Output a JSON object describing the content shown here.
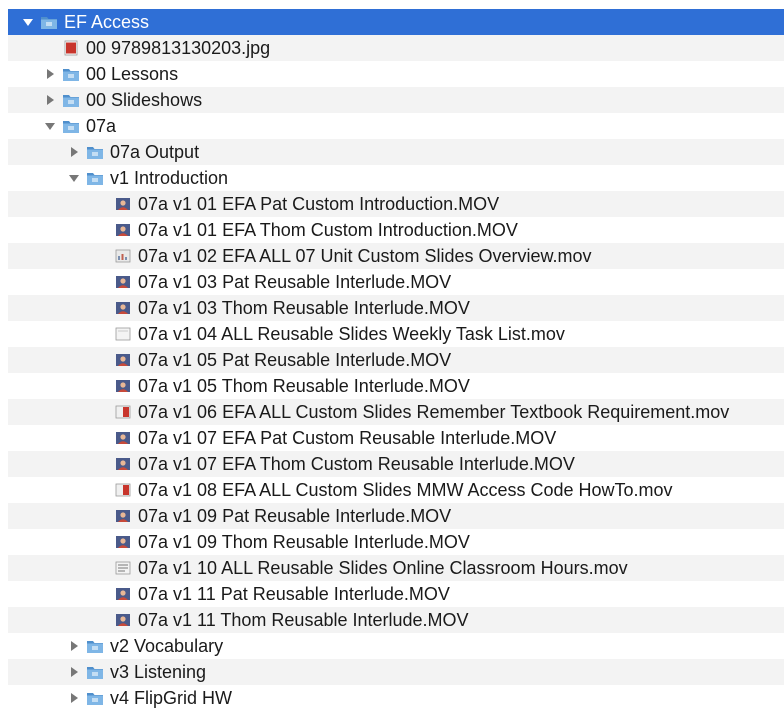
{
  "tree": {
    "rows": [
      {
        "label": "EF Access",
        "level": 0,
        "kind": "folder",
        "state": "expanded",
        "selected": true
      },
      {
        "label": "00 9789813130203.jpg",
        "level": 1,
        "kind": "image-red",
        "state": "none"
      },
      {
        "label": "00 Lessons",
        "level": 1,
        "kind": "folder",
        "state": "collapsed"
      },
      {
        "label": "00 Slideshows",
        "level": 1,
        "kind": "folder",
        "state": "collapsed"
      },
      {
        "label": "07a",
        "level": 1,
        "kind": "folder",
        "state": "expanded"
      },
      {
        "label": "07a Output",
        "level": 2,
        "kind": "folder",
        "state": "collapsed"
      },
      {
        "label": "v1 Introduction",
        "level": 2,
        "kind": "folder",
        "state": "expanded"
      },
      {
        "label": "07a v1 01 EFA Pat Custom Introduction.MOV",
        "level": 3,
        "kind": "video-person",
        "state": "none"
      },
      {
        "label": "07a v1 01 EFA Thom Custom Introduction.MOV",
        "level": 3,
        "kind": "video-person",
        "state": "none"
      },
      {
        "label": "07a v1 02 EFA ALL 07 Unit Custom Slides Overview.mov",
        "level": 3,
        "kind": "video-slide",
        "state": "none"
      },
      {
        "label": "07a v1 03 Pat Reusable Interlude.MOV",
        "level": 3,
        "kind": "video-person",
        "state": "none"
      },
      {
        "label": "07a v1 03 Thom Reusable Interlude.MOV",
        "level": 3,
        "kind": "video-person",
        "state": "none"
      },
      {
        "label": "07a v1 04 ALL Reusable Slides Weekly Task List.mov",
        "level": 3,
        "kind": "video-blank",
        "state": "none"
      },
      {
        "label": "07a v1 05 Pat Reusable Interlude.MOV",
        "level": 3,
        "kind": "video-person",
        "state": "none"
      },
      {
        "label": "07a v1 05 Thom Reusable Interlude.MOV",
        "level": 3,
        "kind": "video-person",
        "state": "none"
      },
      {
        "label": "07a v1 06 EFA ALL Custom Slides Remember Textbook Requirement.mov",
        "level": 3,
        "kind": "video-red",
        "state": "none"
      },
      {
        "label": "07a v1 07 EFA Pat Custom Reusable Interlude.MOV",
        "level": 3,
        "kind": "video-person",
        "state": "none"
      },
      {
        "label": "07a v1 07 EFA Thom Custom Reusable Interlude.MOV",
        "level": 3,
        "kind": "video-person",
        "state": "none"
      },
      {
        "label": "07a v1 08 EFA ALL Custom Slides MMW Access Code HowTo.mov",
        "level": 3,
        "kind": "video-red",
        "state": "none"
      },
      {
        "label": "07a v1 09 Pat Reusable Interlude.MOV",
        "level": 3,
        "kind": "video-person",
        "state": "none"
      },
      {
        "label": "07a v1 09 Thom Reusable Interlude.MOV",
        "level": 3,
        "kind": "video-person",
        "state": "none"
      },
      {
        "label": "07a v1 10 ALL Reusable Slides Online Classroom Hours.mov",
        "level": 3,
        "kind": "video-list",
        "state": "none"
      },
      {
        "label": "07a v1 11 Pat Reusable Interlude.MOV",
        "level": 3,
        "kind": "video-person",
        "state": "none"
      },
      {
        "label": "07a v1 11 Thom Reusable Interlude.MOV",
        "level": 3,
        "kind": "video-person",
        "state": "none"
      },
      {
        "label": "v2 Vocabulary",
        "level": 2,
        "kind": "folder",
        "state": "collapsed"
      },
      {
        "label": "v3 Listening",
        "level": 2,
        "kind": "folder",
        "state": "collapsed"
      },
      {
        "label": "v4 FlipGrid HW",
        "level": 2,
        "kind": "folder",
        "state": "collapsed"
      }
    ]
  },
  "colors": {
    "selection": "#2f6fd6",
    "folder": "#7fb6e6",
    "folder_dark": "#4f8fcc",
    "alt_row": "#f3f3f3"
  }
}
